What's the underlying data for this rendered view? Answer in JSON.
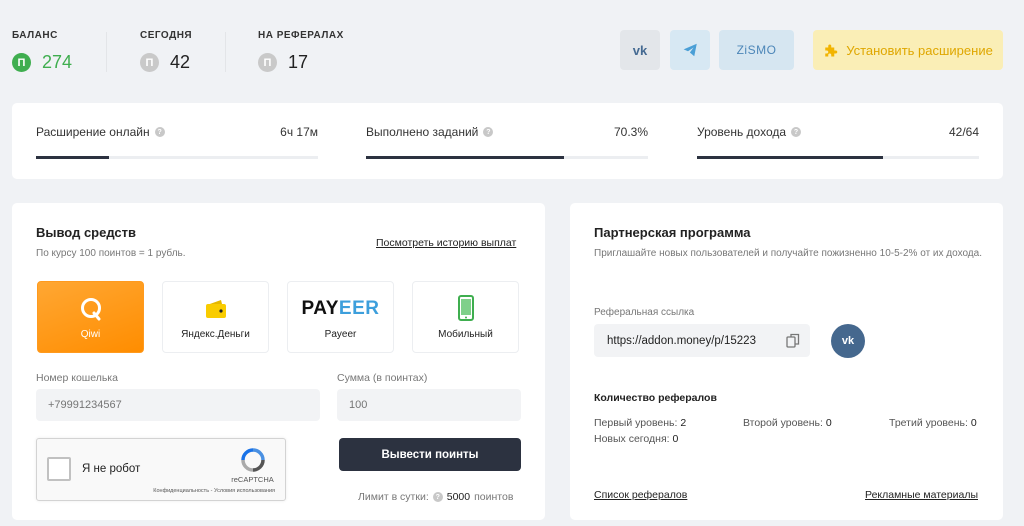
{
  "stats": [
    {
      "label": "БАЛАНС",
      "value": "274",
      "coin": "П"
    },
    {
      "label": "СЕГОДНЯ",
      "value": "42",
      "coin": "П"
    },
    {
      "label": "НА РЕФЕРАЛАХ",
      "value": "17",
      "coin": "П"
    }
  ],
  "topbar": {
    "vk_label": "vk",
    "zismo_label": "ZiSMO",
    "install_label": "Установить расширение"
  },
  "progress": [
    {
      "label": "Расширение онлайн",
      "value": "6ч 17м",
      "fill": 0.26
    },
    {
      "label": "Выполнено заданий",
      "value": "70.3%",
      "fill": 0.703
    },
    {
      "label": "Уровень дохода",
      "value": "42/64",
      "fill": 0.66
    }
  ],
  "withdraw": {
    "title": "Вывод средств",
    "rate": "По курсу 100 поинтов = 1 рубль.",
    "history_link": "Посмотреть историю выплат",
    "methods": [
      {
        "label": "Qiwi",
        "icon": "qiwi-icon"
      },
      {
        "label": "Яндекс.Деньги",
        "icon": "yandex-money-icon"
      },
      {
        "label": "Payeer",
        "icon": "payeer-logo"
      },
      {
        "label": "Мобильный",
        "icon": "mobile-phone-icon"
      }
    ],
    "wallet_label": "Номер кошелька",
    "wallet_placeholder": "+79991234567",
    "sum_label": "Сумма (в поинтах)",
    "sum_placeholder": "100",
    "captcha_text": "Я не робот",
    "captcha_brand": "reCAPTCHA",
    "captcha_terms": "Конфиденциальность - Условия использования",
    "submit_label": "Вывести поинты",
    "limit_prefix": "Лимит в сутки:",
    "limit_value": "5000",
    "limit_suffix": "поинтов"
  },
  "partner": {
    "title": "Партнерская программа",
    "description": "Приглашайте новых пользователей и получайте пожизненно 10-5-2% от их дохода.",
    "ref_label": "Реферальная ссылка",
    "ref_link": "https://addon.money/p/15223",
    "count_title": "Количество рефералов",
    "level1_label": "Первый уровень:",
    "level1_value": "2",
    "level2_label": "Второй уровень:",
    "level2_value": "0",
    "level3_label": "Третий уровень:",
    "level3_value": "0",
    "new_today_label": "Новых сегодня:",
    "new_today_value": "0",
    "list_link": "Список рефералов",
    "promo_link": "Рекламные материалы"
  },
  "colors": {
    "accent_green": "#3fae4f",
    "dark": "#2c3240",
    "qiwi_orange": "#ff9a1e",
    "ext_yellow": "#dfa700"
  }
}
